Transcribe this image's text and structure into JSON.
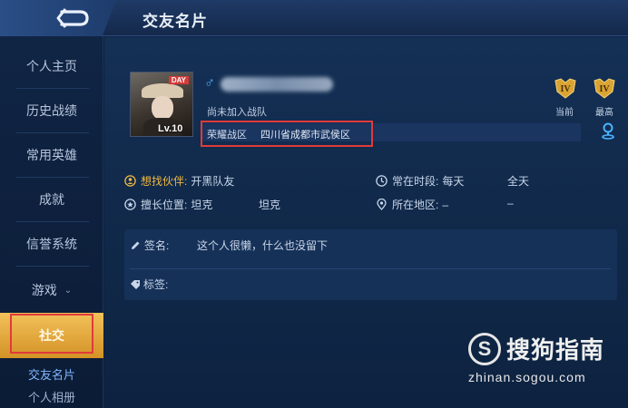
{
  "header": {
    "title": "交友名片",
    "back_icon": "back-arrow-icon"
  },
  "sidebar": {
    "items": [
      {
        "label": "个人主页"
      },
      {
        "label": "历史战绩"
      },
      {
        "label": "常用英雄"
      },
      {
        "label": "成就"
      },
      {
        "label": "信誉系统"
      },
      {
        "label": "游戏"
      },
      {
        "label": "社交"
      }
    ],
    "sub_items": [
      {
        "label": "交友名片"
      },
      {
        "label": "个人相册"
      }
    ],
    "active_item": "社交",
    "highlight_color": "#e23a3a",
    "active_color": "#f2c15a"
  },
  "profile": {
    "avatar": {
      "badge": "DAY",
      "level": "Lv.10"
    },
    "gender_icon": "male-icon",
    "team_status": "尚未加入战队",
    "region": {
      "label": "荣耀战区",
      "value": "四川省成都市武侯区"
    },
    "ranks": [
      {
        "label": "当前",
        "icon": "rank-iv-badge-icon"
      },
      {
        "label": "最高",
        "icon": "rank-iv-badge-icon"
      }
    ],
    "location_icon": "location-pin-icon"
  },
  "info": {
    "partner": {
      "label": "想找伙伴:",
      "value": "开黑队友"
    },
    "online": {
      "label": "常在时段:",
      "value1": "每天",
      "value2": "全天"
    },
    "position": {
      "label": "擅长位置:",
      "value1": "坦克",
      "value2": "坦克"
    },
    "area": {
      "label": "所在地区:",
      "value1": "–",
      "value2": "–"
    }
  },
  "signature": {
    "label": "签名:",
    "value": "这个人很懒，什么也没留下"
  },
  "tags": {
    "label": "标签:"
  },
  "watermark": {
    "logo": "S",
    "text": "搜狗指南",
    "url": "zhinan.sogou.com"
  }
}
